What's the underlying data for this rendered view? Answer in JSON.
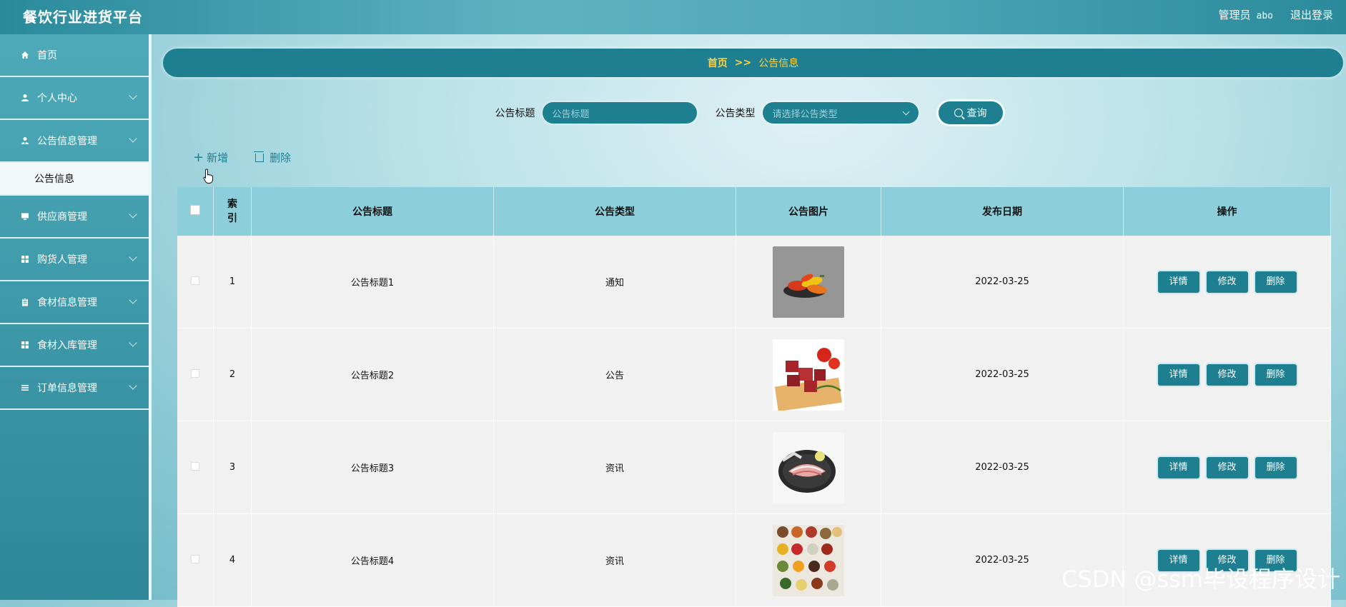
{
  "app": {
    "title": "餐饮行业进货平台"
  },
  "header": {
    "role": "管理员",
    "username": "abo",
    "logout": "退出登录"
  },
  "sidebar": {
    "items": [
      {
        "label": "首页",
        "icon": "home-icon"
      },
      {
        "label": "个人中心",
        "icon": "user-icon"
      },
      {
        "label": "公告信息管理",
        "icon": "user-tie-icon",
        "expanded": true
      },
      {
        "label": "供应商管理",
        "icon": "monitor-icon"
      },
      {
        "label": "购货人管理",
        "icon": "grid-icon"
      },
      {
        "label": "食材信息管理",
        "icon": "clipboard-icon"
      },
      {
        "label": "食材入库管理",
        "icon": "grid-icon"
      },
      {
        "label": "订单信息管理",
        "icon": "list-icon"
      }
    ],
    "sub_active": "公告信息"
  },
  "breadcrumb": {
    "home": "首页",
    "sep": ">>",
    "current": "公告信息"
  },
  "search": {
    "title_label": "公告标题",
    "title_placeholder": "公告标题",
    "type_label": "公告类型",
    "type_placeholder": "请选择公告类型",
    "query_btn": "查询"
  },
  "toolbar": {
    "add": "新增",
    "delete": "删除"
  },
  "table": {
    "headers": {
      "index": "索引",
      "title": "公告标题",
      "type": "公告类型",
      "image": "公告图片",
      "date": "发布日期",
      "ops": "操作"
    },
    "rows": [
      {
        "index": "1",
        "title": "公告标题1",
        "type": "通知",
        "date": "2022-03-25",
        "img": "peppers"
      },
      {
        "index": "2",
        "title": "公告标题2",
        "type": "公告",
        "date": "2022-03-25",
        "img": "beef"
      },
      {
        "index": "3",
        "title": "公告标题3",
        "type": "资讯",
        "date": "2022-03-25",
        "img": "bacon"
      },
      {
        "index": "4",
        "title": "公告标题4",
        "type": "资讯",
        "date": "2022-03-25",
        "img": "spices"
      }
    ],
    "ops": {
      "detail": "详情",
      "edit": "修改",
      "delete": "删除"
    }
  },
  "watermark": "CSDN @ssm毕设程序设计",
  "colors": {
    "accent": "#1e7f90",
    "header_row": "#8ccfda",
    "breadcrumb_text": "#f7d24a"
  }
}
